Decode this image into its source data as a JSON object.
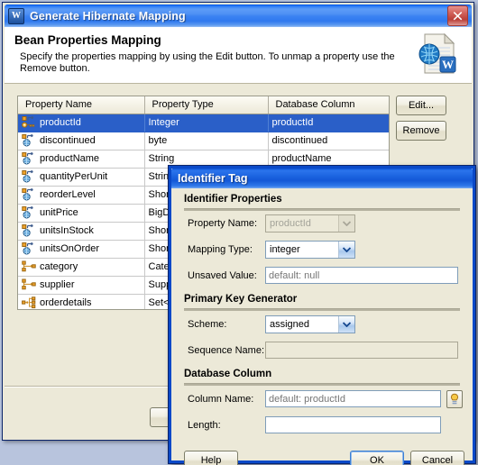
{
  "wizard": {
    "title": "Generate Hibernate Mapping",
    "app_icon": "W",
    "close_icon": "close-icon",
    "heading": "Bean Properties Mapping",
    "description": "Specify the properties mapping by using the Edit button. To unmap a property use the Remove button.",
    "header_icon": "hibernate-mapping-document-icon",
    "table": {
      "columns": [
        "Property Name",
        "Property Type",
        "Database Column"
      ],
      "rows": [
        {
          "icon": "primary-key-icon",
          "name": "productId",
          "type": "Integer",
          "column": "productId",
          "selected": true
        },
        {
          "icon": "property-icon",
          "name": "discontinued",
          "type": "byte",
          "column": "discontinued",
          "selected": false
        },
        {
          "icon": "property-icon",
          "name": "productName",
          "type": "String",
          "column": "productName",
          "selected": false
        },
        {
          "icon": "property-icon",
          "name": "quantityPerUnit",
          "type": "String",
          "column": "",
          "selected": false
        },
        {
          "icon": "property-icon",
          "name": "reorderLevel",
          "type": "Short",
          "column": "",
          "selected": false
        },
        {
          "icon": "property-icon",
          "name": "unitPrice",
          "type": "BigDecimal",
          "column": "",
          "selected": false
        },
        {
          "icon": "property-icon",
          "name": "unitsInStock",
          "type": "Short",
          "column": "",
          "selected": false
        },
        {
          "icon": "property-icon",
          "name": "unitsOnOrder",
          "type": "Short",
          "column": "",
          "selected": false
        },
        {
          "icon": "association-icon",
          "name": "category",
          "type": "Category",
          "column": "",
          "selected": false
        },
        {
          "icon": "association-icon",
          "name": "supplier",
          "type": "Supplier",
          "column": "",
          "selected": false
        },
        {
          "icon": "collection-icon",
          "name": "orderdetails",
          "type": "Set<Orderdetail>",
          "column": "",
          "selected": false
        }
      ]
    },
    "edit_button": "Edit...",
    "remove_button": "Remove",
    "footer_button": ""
  },
  "identifier_dialog": {
    "title": "Identifier Tag",
    "groups": {
      "identifier_properties": "Identifier Properties",
      "primary_key_generator": "Primary Key Generator",
      "database_column": "Database Column"
    },
    "fields": {
      "property_name_label": "Property Name:",
      "property_name_value": "productId",
      "mapping_type_label": "Mapping Type:",
      "mapping_type_value": "integer",
      "unsaved_value_label": "Unsaved Value:",
      "unsaved_value_placeholder": "default: null",
      "scheme_label": "Scheme:",
      "scheme_value": "assigned",
      "sequence_name_label": "Sequence Name:",
      "sequence_name_value": "",
      "column_name_label": "Column Name:",
      "column_name_placeholder": "default: productId",
      "length_label": "Length:",
      "length_value": "",
      "browse_icon": "lightbulb-icon"
    },
    "buttons": {
      "help": "Help",
      "ok": "OK",
      "cancel": "Cancel"
    }
  },
  "colors": {
    "titlebar_blue": "#1e66e2",
    "selection_blue": "#2a5fc8",
    "dialog_face": "#ece9d8",
    "close_red": "#b93f38",
    "key_orange": "#e8a33d"
  }
}
